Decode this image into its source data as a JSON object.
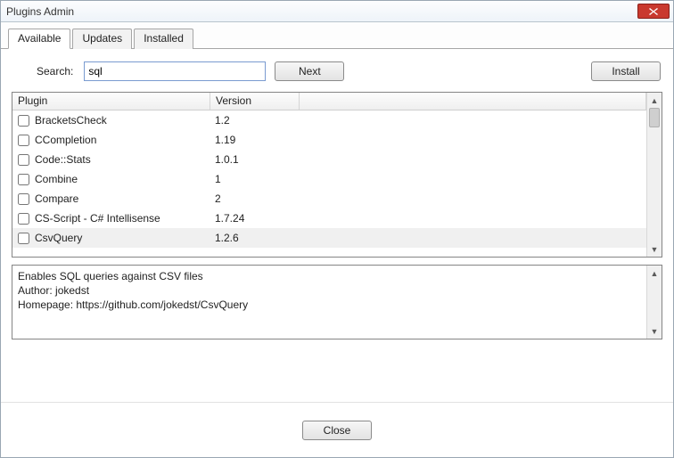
{
  "title": "Plugins Admin",
  "tabs": [
    {
      "label": "Available",
      "active": true
    },
    {
      "label": "Updates",
      "active": false
    },
    {
      "label": "Installed",
      "active": false
    }
  ],
  "search": {
    "label": "Search:",
    "value": "sql",
    "next_label": "Next"
  },
  "install_label": "Install",
  "columns": {
    "plugin": "Plugin",
    "version": "Version"
  },
  "rows": [
    {
      "name": "BracketsCheck",
      "version": "1.2",
      "checked": false,
      "selected": false
    },
    {
      "name": "CCompletion",
      "version": "1.19",
      "checked": false,
      "selected": false
    },
    {
      "name": "Code::Stats",
      "version": "1.0.1",
      "checked": false,
      "selected": false
    },
    {
      "name": "Combine",
      "version": "1",
      "checked": false,
      "selected": false
    },
    {
      "name": "Compare",
      "version": "2",
      "checked": false,
      "selected": false
    },
    {
      "name": "CS-Script - C# Intellisense",
      "version": "1.7.24",
      "checked": false,
      "selected": false
    },
    {
      "name": "CsvQuery",
      "version": "1.2.6",
      "checked": false,
      "selected": true
    }
  ],
  "description": "Enables SQL queries against CSV files\nAuthor: jokedst\nHomepage: https://github.com/jokedst/CsvQuery",
  "close_label": "Close"
}
